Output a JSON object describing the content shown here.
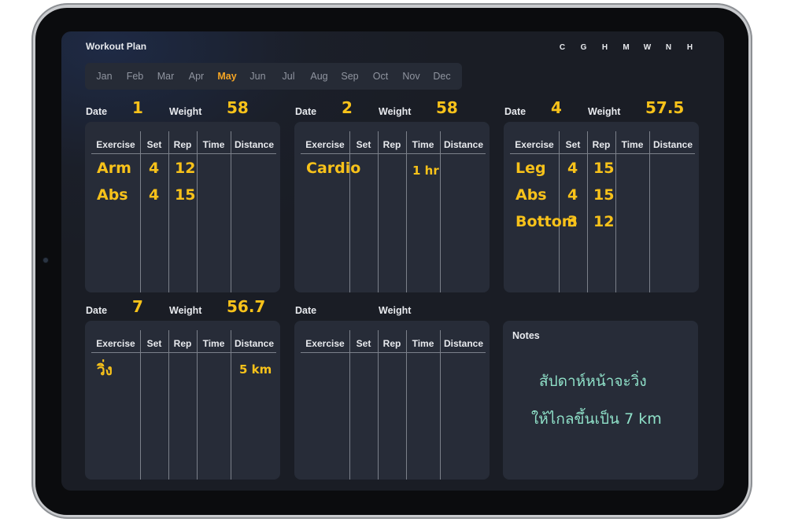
{
  "app": {
    "title": "Workout Plan"
  },
  "weekdays": [
    "C",
    "G",
    "H",
    "M",
    "W",
    "N",
    "H"
  ],
  "months": [
    "Jan",
    "Feb",
    "Mar",
    "Apr",
    "May",
    "Jun",
    "Jul",
    "Aug",
    "Sep",
    "Oct",
    "Nov",
    "Dec"
  ],
  "selected_month": "May",
  "labels": {
    "date": "Date",
    "weight": "Weight"
  },
  "columns": [
    "Exercise",
    "Set",
    "Rep",
    "Time",
    "Distance"
  ],
  "cards": [
    {
      "date": "1",
      "weight": "58",
      "rows": [
        {
          "exercise": "Arm",
          "set": "4",
          "rep": "12",
          "time": "",
          "distance": ""
        },
        {
          "exercise": "Abs",
          "set": "4",
          "rep": "15",
          "time": "",
          "distance": ""
        }
      ]
    },
    {
      "date": "2",
      "weight": "58",
      "rows": [
        {
          "exercise": "Cardio",
          "set": "",
          "rep": "",
          "time": "1 hr",
          "distance": ""
        }
      ]
    },
    {
      "date": "4",
      "weight": "57.5",
      "rows": [
        {
          "exercise": "Leg",
          "set": "4",
          "rep": "15",
          "time": "",
          "distance": ""
        },
        {
          "exercise": "Abs",
          "set": "4",
          "rep": "15",
          "time": "",
          "distance": ""
        },
        {
          "exercise": "Bottom",
          "set": "3",
          "rep": "12",
          "time": "",
          "distance": ""
        }
      ]
    },
    {
      "date": "7",
      "weight": "56.7",
      "rows": [
        {
          "exercise": "วิ่ง",
          "set": "",
          "rep": "",
          "time": "",
          "distance": "5 km"
        }
      ]
    },
    {
      "date": "",
      "weight": "",
      "rows": []
    }
  ],
  "notes": {
    "title": "Notes",
    "lines": [
      "สัปดาห์หน้าจะวิ่ง",
      "ให้ไกลขึ้นเป็น 7 km"
    ]
  },
  "colors": {
    "accent": "#f5a524",
    "handwriting": "#f8c21a",
    "note_handwriting": "#8fe0c8",
    "card_bg": "#272c38",
    "screen_bg": "#1b1f29"
  }
}
